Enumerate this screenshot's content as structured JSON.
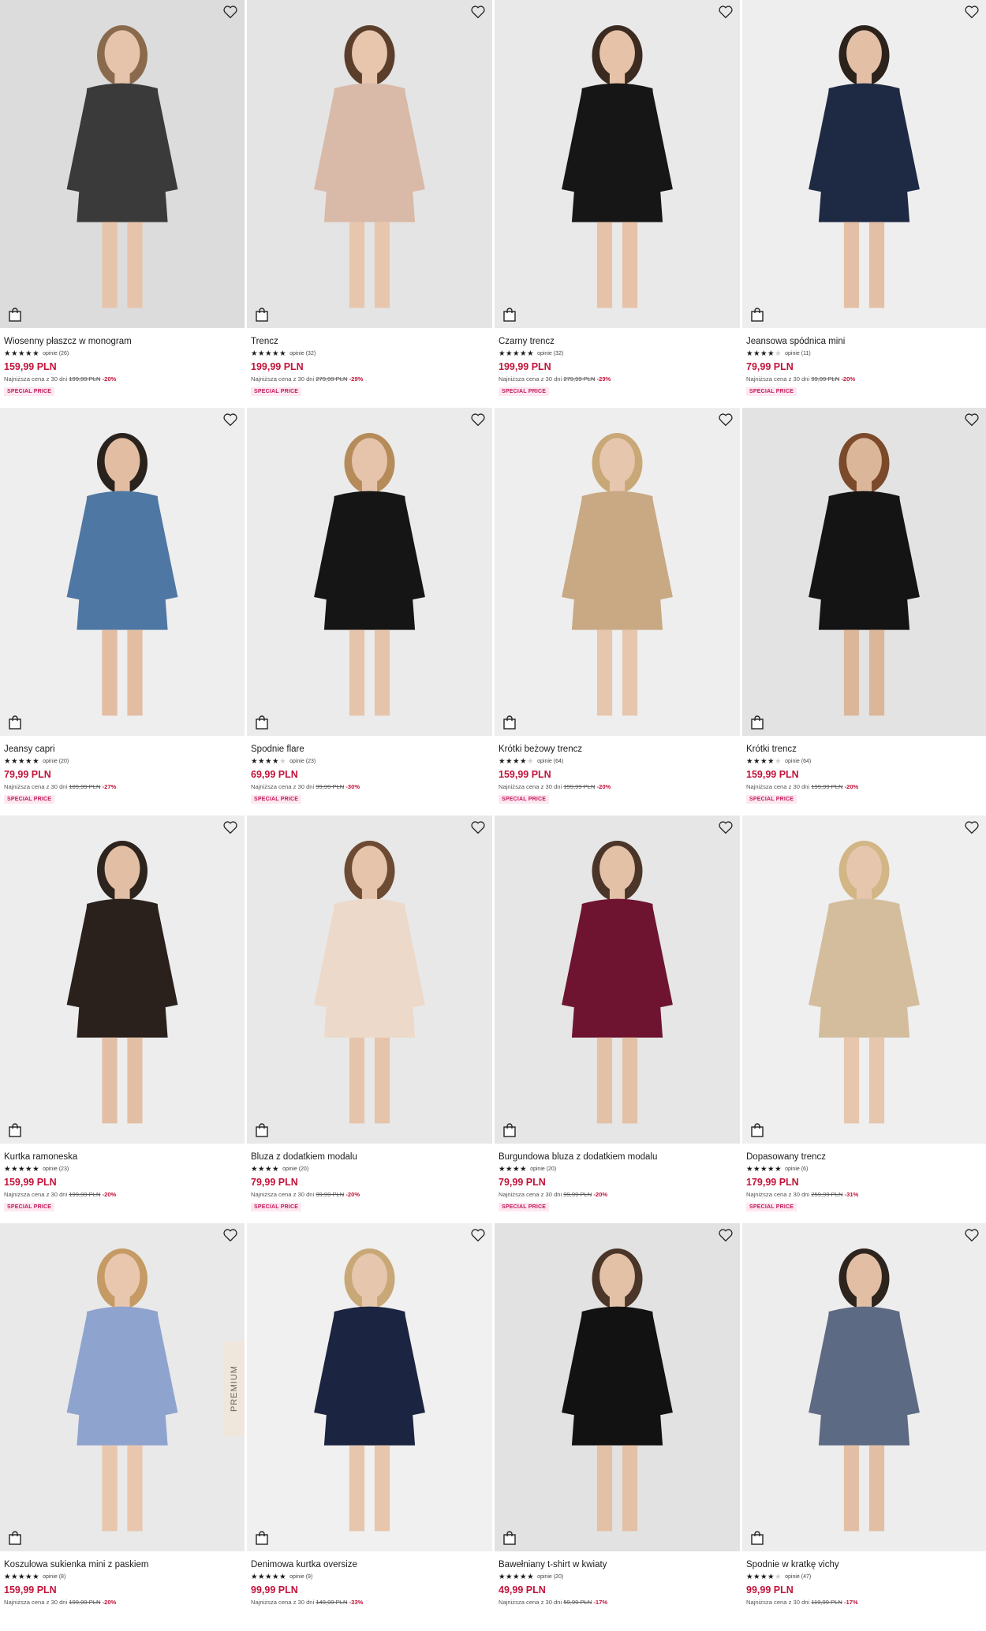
{
  "accent_color": "#c2133a",
  "badge_color": "#fde8f1",
  "products": [
    {
      "name": "Wiosenny płaszcz w monogram",
      "stars": "★★★★★",
      "stars_off": "",
      "reviews": "opinie (26)",
      "price": "159,99 PLN",
      "lowest_prefix": "Najniższa cena z 30 dni",
      "old_price": "199,99 PLN",
      "discount": "-20%",
      "badge": "SPECIAL PRICE",
      "bg": "#dcdcdc",
      "outfit": "#3a3a3a",
      "skin": "#e6c4ab",
      "hair": "#8a6a4c"
    },
    {
      "name": "Trencz",
      "stars": "★★★★★",
      "stars_off": "",
      "reviews": "opinie (32)",
      "price": "199,99 PLN",
      "lowest_prefix": "Najniższa cena z 30 dni",
      "old_price": "279,99 PLN",
      "discount": "-29%",
      "badge": "SPECIAL PRICE",
      "bg": "#e4e4e4",
      "outfit": "#d9b9a8",
      "skin": "#e8c6ae",
      "hair": "#5a3e2b"
    },
    {
      "name": "Czarny trencz",
      "stars": "★★★★★",
      "stars_off": "",
      "reviews": "opinie (32)",
      "price": "199,99 PLN",
      "lowest_prefix": "Najniższa cena z 30 dni",
      "old_price": "279,99 PLN",
      "discount": "-29%",
      "badge": "SPECIAL PRICE",
      "bg": "#e9e9e9",
      "outfit": "#161616",
      "skin": "#e6c2a8",
      "hair": "#3a2a20"
    },
    {
      "name": "Jeansowa spódnica mini",
      "stars": "★★★★",
      "stars_off": "★",
      "reviews": "opinie (11)",
      "price": "79,99 PLN",
      "lowest_prefix": "Najniższa cena z 30 dni",
      "old_price": "99,99 PLN",
      "discount": "-20%",
      "badge": "SPECIAL PRICE",
      "bg": "#eeeeee",
      "outfit": "#1e2a44",
      "skin": "#e3bfa5",
      "hair": "#2c221c"
    },
    {
      "name": "Jeansy capri",
      "stars": "★★★★★",
      "stars_off": "",
      "reviews": "opinie (20)",
      "price": "79,99 PLN",
      "lowest_prefix": "Najniższa cena z 30 dni",
      "old_price": "109,99 PLN",
      "discount": "-27%",
      "badge": "SPECIAL PRICE",
      "bg": "#eeeeee",
      "outfit": "#4f77a4",
      "skin": "#e2bda2",
      "hair": "#2a221d"
    },
    {
      "name": "Spodnie flare",
      "stars": "★★★★",
      "stars_off": "★",
      "reviews": "opinie (23)",
      "price": "69,99 PLN",
      "lowest_prefix": "Najniższa cena z 30 dni",
      "old_price": "99,99 PLN",
      "discount": "-30%",
      "badge": "SPECIAL PRICE",
      "bg": "#ebebeb",
      "outfit": "#151515",
      "skin": "#e6c4ab",
      "hair": "#b58b5a"
    },
    {
      "name": "Krótki beżowy trencz",
      "stars": "★★★★",
      "stars_off": "★",
      "reviews": "opinie (64)",
      "price": "159,99 PLN",
      "lowest_prefix": "Najniższa cena z 30 dni",
      "old_price": "199,99 PLN",
      "discount": "-20%",
      "badge": "SPECIAL PRICE",
      "bg": "#eeeeee",
      "outfit": "#c8a984",
      "skin": "#e6c6ad",
      "hair": "#c9a877"
    },
    {
      "name": "Krótki trencz",
      "stars": "★★★★",
      "stars_off": "★",
      "reviews": "opinie (64)",
      "price": "159,99 PLN",
      "lowest_prefix": "Najniższa cena z 30 dni",
      "old_price": "199,99 PLN",
      "discount": "-20%",
      "badge": "SPECIAL PRICE",
      "bg": "#e3e3e3",
      "outfit": "#141414",
      "skin": "#dcb699",
      "hair": "#7a4a2a"
    },
    {
      "name": "Kurtka ramoneska",
      "stars": "★★★★★",
      "stars_off": "",
      "reviews": "opinie (23)",
      "price": "159,99 PLN",
      "lowest_prefix": "Najniższa cena z 30 dni",
      "old_price": "199,99 PLN",
      "discount": "-20%",
      "badge": "SPECIAL PRICE",
      "bg": "#ededed",
      "outfit": "#2a211d",
      "skin": "#e2bfa4",
      "hair": "#2d241e"
    },
    {
      "name": "Bluza z dodatkiem modalu",
      "stars": "★★★★",
      "stars_off": "",
      "reviews": "opinie (20)",
      "price": "79,99 PLN",
      "lowest_prefix": "Najniższa cena z 30 dni",
      "old_price": "99,99 PLN",
      "discount": "-20%",
      "badge": "SPECIAL PRICE",
      "bg": "#e8e8e8",
      "outfit": "#ecd9c9",
      "skin": "#e6c4ab",
      "hair": "#6d4a33"
    },
    {
      "name": "Burgundowa bluza z dodatkiem modalu",
      "stars": "★★★★",
      "stars_off": "",
      "reviews": "opinie (20)",
      "price": "79,99 PLN",
      "lowest_prefix": "Najniższa cena z 30 dni",
      "old_price": "99,99 PLN",
      "discount": "-20%",
      "badge": "SPECIAL PRICE",
      "bg": "#e6e6e6",
      "outfit": "#6e1430",
      "skin": "#e3c1a7",
      "hair": "#4a3528"
    },
    {
      "name": "Dopasowany trencz",
      "stars": "★★★★★",
      "stars_off": "",
      "reviews": "opinie (6)",
      "price": "179,99 PLN",
      "lowest_prefix": "Najniższa cena z 30 dni",
      "old_price": "259,99 PLN",
      "discount": "-31%",
      "badge": "SPECIAL PRICE",
      "bg": "#efefef",
      "outfit": "#d4bd9d",
      "skin": "#e6c6ad",
      "hair": "#d3b685"
    },
    {
      "name": "Koszulowa sukienka mini z paskiem",
      "stars": "★★★★★",
      "stars_off": "",
      "reviews": "opinie (8)",
      "price": "159,99 PLN",
      "lowest_prefix": "Najniższa cena z 30 dni",
      "old_price": "199,99 PLN",
      "discount": "-20%",
      "badge": "",
      "premium": "PREMIUM",
      "bg": "#e9e9e9",
      "outfit": "#8fa3cf",
      "skin": "#e8c7ae",
      "hair": "#c59a64"
    },
    {
      "name": "Denimowa kurtka oversize",
      "stars": "★★★★★",
      "stars_off": "",
      "reviews": "opinie (9)",
      "price": "99,99 PLN",
      "lowest_prefix": "Najniższa cena z 30 dni",
      "old_price": "149,99 PLN",
      "discount": "-33%",
      "badge": "",
      "bg": "#f0f0f0",
      "outfit": "#1b2440",
      "skin": "#e6c6ad",
      "hair": "#c9a877"
    },
    {
      "name": "Bawełniany t-shirt w kwiaty",
      "stars": "★★★★★",
      "stars_off": "",
      "reviews": "opinie (20)",
      "price": "49,99 PLN",
      "lowest_prefix": "Najniższa cena z 30 dni",
      "old_price": "59,99 PLN",
      "discount": "-17%",
      "badge": "",
      "bg": "#e2e2e2",
      "outfit": "#121212",
      "skin": "#e3c1a6",
      "hair": "#4a3528"
    },
    {
      "name": "Spodnie w kratkę vichy",
      "stars": "★★★★",
      "stars_off": "★",
      "reviews": "opinie (47)",
      "price": "99,99 PLN",
      "lowest_prefix": "Najniższa cena z 30 dni",
      "old_price": "119,99 PLN",
      "discount": "-17%",
      "badge": "",
      "bg": "#ededed",
      "outfit": "#5d6a84",
      "skin": "#e2bfa4",
      "hair": "#2d241e"
    }
  ]
}
